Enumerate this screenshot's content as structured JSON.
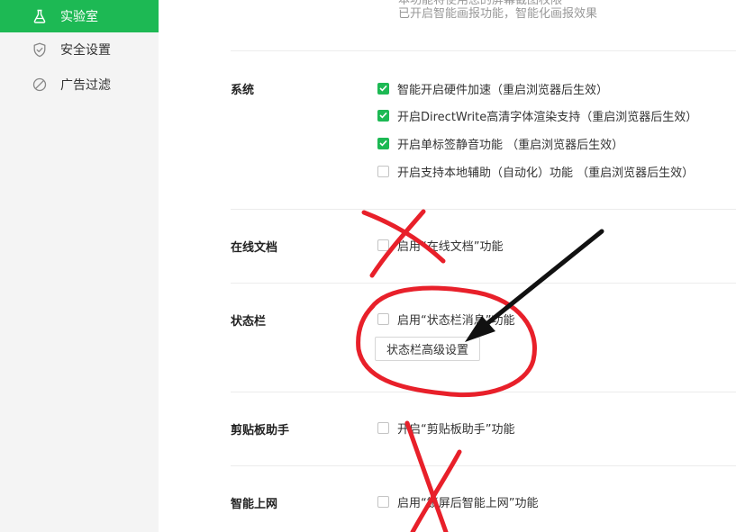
{
  "sidebar": {
    "items": [
      {
        "label": "实验室",
        "icon": "flask-icon",
        "active": true
      },
      {
        "label": "安全设置",
        "icon": "shield-icon",
        "active": false
      },
      {
        "label": "广告过滤",
        "icon": "block-icon",
        "active": false
      }
    ]
  },
  "top_notes": {
    "line1": "本功能将使用您的屏幕截图权限",
    "line2": "已开启智能画报功能，智能化画报效果"
  },
  "sections": {
    "system": {
      "title": "系统",
      "options": [
        {
          "label": "智能开启硬件加速（重启浏览器后生效）",
          "checked": true
        },
        {
          "label": "开启DirectWrite高清字体渲染支持（重启浏览器后生效）",
          "checked": true
        },
        {
          "label": "开启单标签静音功能 （重启浏览器后生效）",
          "checked": true
        },
        {
          "label": "开启支持本地辅助（自动化）功能 （重启浏览器后生效）",
          "checked": false
        }
      ]
    },
    "online_docs": {
      "title": "在线文档",
      "option": {
        "label": "启用“在线文档”功能",
        "checked": false
      }
    },
    "status_bar": {
      "title": "状态栏",
      "option": {
        "label": "启用“状态栏消息”功能",
        "checked": false
      },
      "button_label": "状态栏高级设置"
    },
    "clipboard": {
      "title": "剪贴板助手",
      "option": {
        "label": "开启“剪贴板助手”功能",
        "checked": false
      }
    },
    "smart_net": {
      "title": "智能上网",
      "option": {
        "label": "启用“锁屏后智能上网”功能",
        "checked": false
      }
    }
  },
  "colors": {
    "accent": "#1db954",
    "annotation_red": "#e8202a",
    "sidebar_bg": "#f4f4f4"
  }
}
